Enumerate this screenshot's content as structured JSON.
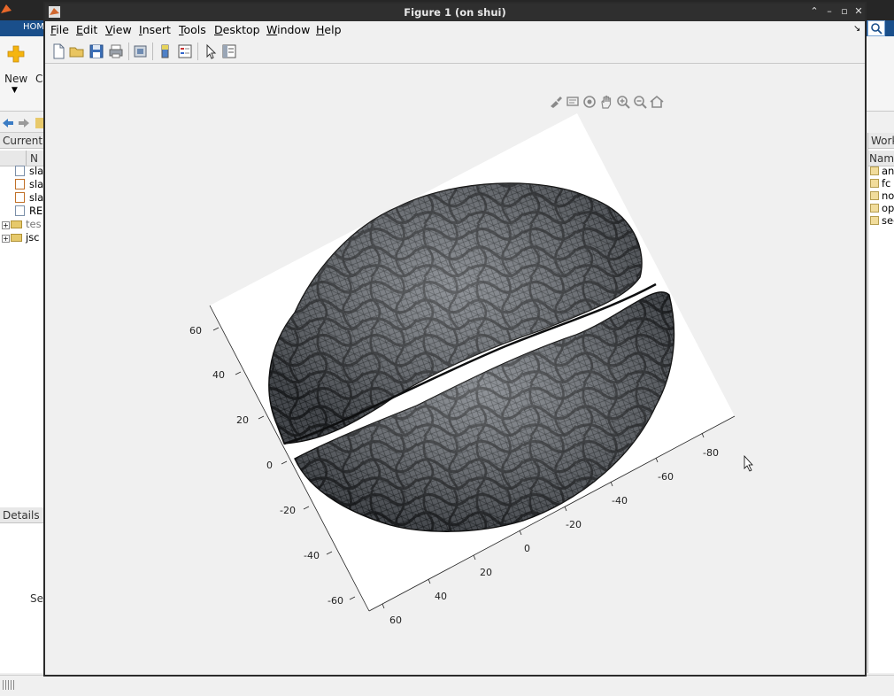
{
  "background": {
    "ribbon_tab": "HOM",
    "ribbon_tab2": "C",
    "new_label": "New",
    "current_folder_label": "Current",
    "col_name": "N",
    "files": [
      {
        "name": "sla",
        "kind": "file"
      },
      {
        "name": "sla",
        "kind": "mfile"
      },
      {
        "name": "sla",
        "kind": "mfile"
      },
      {
        "name": "RE",
        "kind": "file"
      }
    ],
    "folders": [
      {
        "name": "tes"
      },
      {
        "name": "jsc"
      }
    ],
    "details_label": "Details",
    "details_text": "Se",
    "workspace_label": "Work",
    "ws_col_name": "Name",
    "workspace_vars": [
      "ans",
      "fc",
      "no",
      "opt",
      "seg"
    ]
  },
  "figure": {
    "title": "Figure 1 (on shui)",
    "menus": [
      {
        "label": "File",
        "key": "F"
      },
      {
        "label": "Edit",
        "key": "E"
      },
      {
        "label": "View",
        "key": "V"
      },
      {
        "label": "Insert",
        "key": "I"
      },
      {
        "label": "Tools",
        "key": "T"
      },
      {
        "label": "Desktop",
        "key": "D"
      },
      {
        "label": "Window",
        "key": "W"
      },
      {
        "label": "Help",
        "key": "H"
      }
    ],
    "toolbar": [
      "new-figure",
      "open",
      "save",
      "print",
      "print-preview",
      "colorbar",
      "legend",
      "select",
      "property-inspector"
    ],
    "axes_toolbar": [
      "brush",
      "data-tips",
      "rotate",
      "pan",
      "zoom-in",
      "zoom-out",
      "home"
    ],
    "axis_a_ticks": [
      "60",
      "40",
      "20",
      "0",
      "-20",
      "-40",
      "-60"
    ],
    "axis_b_ticks": [
      "60",
      "40",
      "20",
      "0",
      "-20",
      "-40",
      "-60",
      "-80"
    ],
    "mesh_color": "#4a4f55"
  }
}
